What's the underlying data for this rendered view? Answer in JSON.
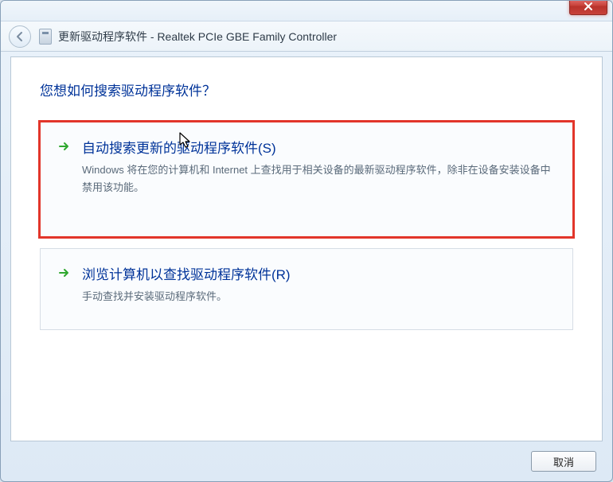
{
  "window": {
    "title": "更新驱动程序软件 - Realtek PCIe GBE Family Controller"
  },
  "heading": "您想如何搜索驱动程序软件？",
  "options": [
    {
      "title": "自动搜索更新的驱动程序软件(S)",
      "desc": "Windows 将在您的计算机和 Internet 上查找用于相关设备的最新驱动程序软件，除非在设备安装设备中禁用该功能。"
    },
    {
      "title": "浏览计算机以查找驱动程序软件(R)",
      "desc": "手动查找并安装驱动程序软件。"
    }
  ],
  "footer": {
    "cancel": "取消"
  }
}
